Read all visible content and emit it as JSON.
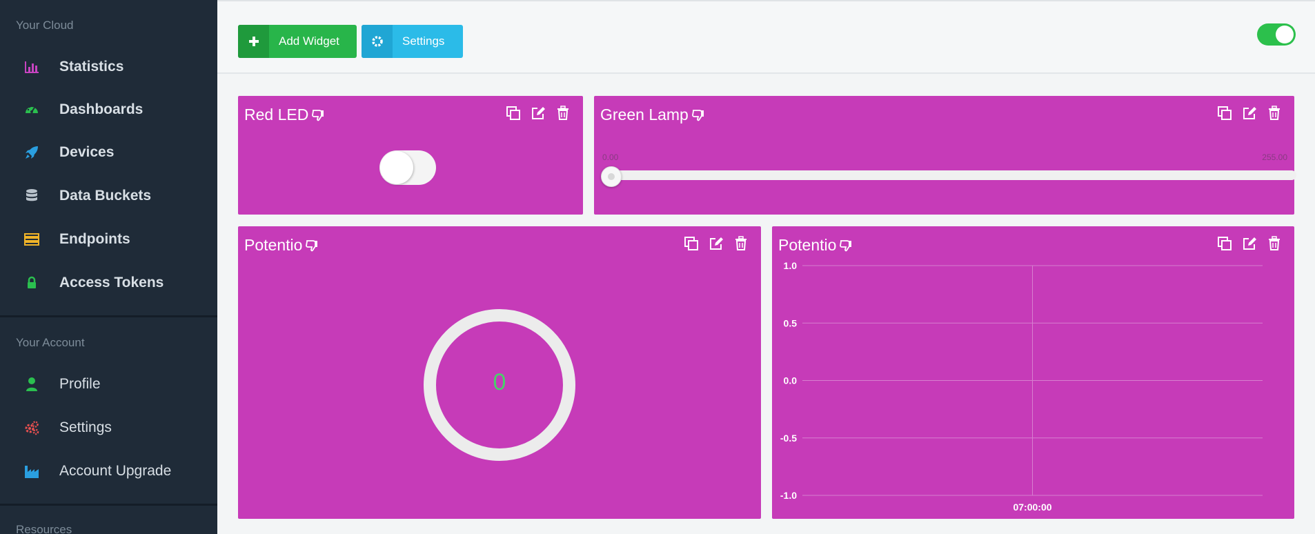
{
  "sidebar": {
    "section_cloud": "Your Cloud",
    "cloud_items": [
      {
        "label": "Statistics",
        "icon": "bar-chart-icon",
        "color": "#c644c0"
      },
      {
        "label": "Dashboards",
        "icon": "dashboard-gauge-icon",
        "color": "#2bbf4f"
      },
      {
        "label": "Devices",
        "icon": "rocket-icon",
        "color": "#2a9fe0"
      },
      {
        "label": "Data Buckets",
        "icon": "database-icon",
        "color": "#b8c2cb"
      },
      {
        "label": "Endpoints",
        "icon": "server-icon",
        "color": "#f0b428"
      },
      {
        "label": "Access Tokens",
        "icon": "lock-icon",
        "color": "#2bbf4f"
      }
    ],
    "section_account": "Your Account",
    "account_items": [
      {
        "label": "Profile",
        "icon": "user-icon",
        "color": "#2bbf4f"
      },
      {
        "label": "Settings",
        "icon": "gears-icon",
        "color": "#e85050"
      },
      {
        "label": "Account Upgrade",
        "icon": "industry-icon",
        "color": "#2a9fe0"
      }
    ],
    "section_resources": "Resources"
  },
  "toolbar": {
    "add_widget_label": "Add Widget",
    "settings_label": "Settings",
    "toggle_on": true
  },
  "widgets": {
    "red_led": {
      "title": "Red LED",
      "state": false
    },
    "green_lamp": {
      "title": "Green Lamp",
      "min_label": "0.00",
      "max_label": "255.00",
      "value": 0
    },
    "potentio_gauge": {
      "title": "Potentio",
      "value": "0"
    },
    "potentio_chart": {
      "title": "Potentio"
    }
  },
  "chart_data": {
    "type": "line",
    "title": "",
    "xlabel": "",
    "ylabel": "",
    "x_ticks": [
      "07:00:00"
    ],
    "y_ticks": [
      "1.0",
      "0.5",
      "0.0",
      "-0.5",
      "-1.0"
    ],
    "ylim": [
      -1.0,
      1.0
    ],
    "series": [],
    "grid": true
  },
  "colors": {
    "widget_bg": "#c63bb8",
    "sidebar_bg": "#1f2b38",
    "add_green": "#28b54a",
    "settings_blue": "#2bbbe8"
  }
}
